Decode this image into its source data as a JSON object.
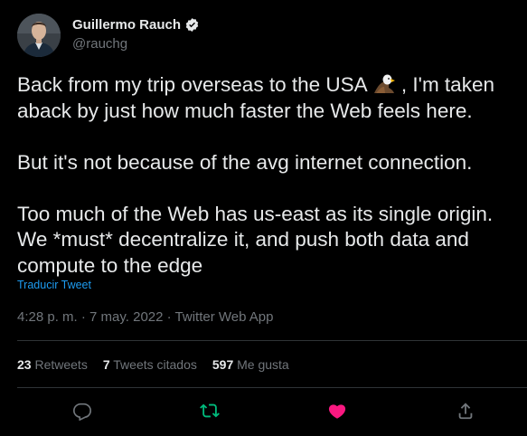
{
  "author": {
    "name": "Guillermo Rauch",
    "handle": "@rauchg",
    "avatar_icon": "profile-avatar",
    "verified_icon": "verified-badge-icon"
  },
  "tweet": {
    "para1_before_emoji": "Back from my trip overseas to the USA ",
    "emoji": "eagle-emoji",
    "para1_after_emoji": " , I'm taken aback by just how much faster the Web feels here.",
    "para2": "But it's not because of the avg internet connection.",
    "para3": "Too much of the Web has us-east as its single origin. We *must* decentralize it, and push both data and compute to the edge",
    "translate_label": "Traducir Tweet",
    "timestamp": "4:28 p. m. · 7 may. 2022 · Twitter Web App"
  },
  "stats": {
    "retweets_count": "23",
    "retweets_label": " Retweets",
    "quotes_count": "7",
    "quotes_label": " Tweets citados",
    "likes_count": "597",
    "likes_label": " Me gusta"
  },
  "actions": {
    "reply_icon": "reply-icon",
    "retweet_icon": "retweet-icon",
    "like_icon": "heart-icon",
    "share_icon": "share-icon"
  },
  "colors": {
    "background": "#000000",
    "text": "#e7e9ea",
    "secondary": "#71767b",
    "link": "#1d9bf0",
    "retweet_active": "#00ba7c",
    "like_active": "#f91880",
    "divider": "#2f3336"
  }
}
